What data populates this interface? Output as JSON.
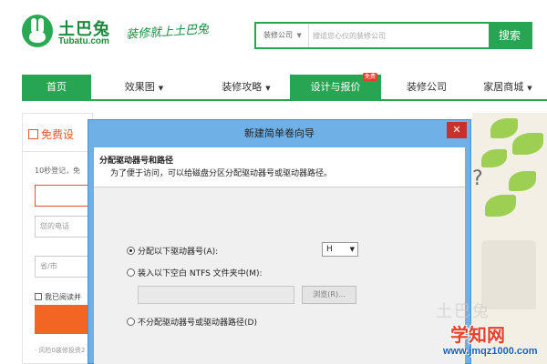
{
  "header": {
    "logo_cn": "土巴兔",
    "logo_en": "Tubatu.com",
    "slogan": "装修就上土巴兔",
    "search": {
      "category": "装修公司",
      "placeholder": "搜适您心仪的装修公司",
      "button": "搜索"
    }
  },
  "nav": {
    "items": [
      {
        "label": "首页"
      },
      {
        "label": "效果图",
        "dropdown": "▼"
      },
      {
        "label": "装修攻略",
        "dropdown": "▼"
      },
      {
        "label": "设计与报价",
        "badge": "免费"
      },
      {
        "label": "装修公司"
      },
      {
        "label": "家居商城",
        "dropdown": "▼"
      }
    ]
  },
  "form": {
    "title": "免费设",
    "hint": "10秒登记，免",
    "field_phone": "您的电话",
    "field_city": "省/市",
    "agree": "我已阅读并",
    "note": "· 风险0装修投资2"
  },
  "photo": {
    "glyph": "?"
  },
  "dialog": {
    "title": "新建简单卷向导",
    "close": "✕",
    "heading": "分配驱动器号和路径",
    "subheading": "为了便于访问，可以给磁盘分区分配驱动器号或驱动器路径。",
    "option_letter": "分配以下驱动器号(A):",
    "drive_letter": "H",
    "option_folder": "装入以下空白 NTFS 文件夹中(M):",
    "browse": "浏览(R)...",
    "option_none": "不分配驱动器号或驱动器路径(D)"
  },
  "watermark": {
    "ghost": "土巴兔",
    "brand": "学知网",
    "url": "www.jmqz1000.com"
  }
}
